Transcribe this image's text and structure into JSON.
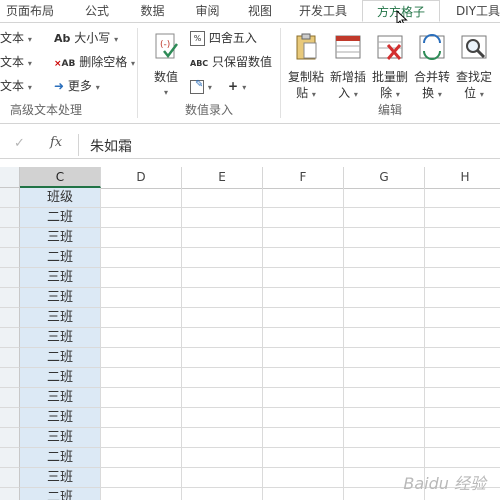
{
  "tabs": [
    {
      "label": "页面布局"
    },
    {
      "label": "公式"
    },
    {
      "label": "数据"
    },
    {
      "label": "审阅"
    },
    {
      "label": "视图"
    },
    {
      "label": "开发工具"
    },
    {
      "label": "方方格子"
    },
    {
      "label": "DIY工具"
    }
  ],
  "ribbon": {
    "text_group": {
      "left_items": [
        "文本",
        "文本",
        "文本"
      ],
      "case_label": "大小写",
      "case_icon_text": "Ab",
      "delete_space_label": "删除空格",
      "delete_space_icon_text": "AB",
      "more_label": "更多",
      "group_label": "高级文本处理"
    },
    "number_group": {
      "value_label": "数值",
      "round_label": "四舍五入",
      "keep_value_label": "只保留数值",
      "keep_value_icon_text": "ABC",
      "plus_label": "+",
      "group_label": "数值录入"
    },
    "edit_group": {
      "buttons": [
        {
          "line1": "复制粘",
          "line2": "贴"
        },
        {
          "line1": "新增插",
          "line2": "入"
        },
        {
          "line1": "批量删",
          "line2": "除"
        },
        {
          "line1": "合并转",
          "line2": "换"
        },
        {
          "line1": "查找定",
          "line2": "位"
        }
      ],
      "group_label": "编辑"
    }
  },
  "formula_bar": {
    "cancel_symbol": "✓",
    "fx_label": "fx",
    "value": "朱如霜"
  },
  "columns": [
    "C",
    "D",
    "E",
    "F",
    "G",
    "H"
  ],
  "selected_column": "C",
  "rows": [
    "班级",
    "二班",
    "三班",
    "二班",
    "三班",
    "三班",
    "三班",
    "三班",
    "二班",
    "二班",
    "三班",
    "三班",
    "三班",
    "二班",
    "三班",
    "二班"
  ],
  "watermark": "Baidu 经验",
  "colors": {
    "accent": "#217346",
    "column_highlight": "#dce9f5"
  }
}
